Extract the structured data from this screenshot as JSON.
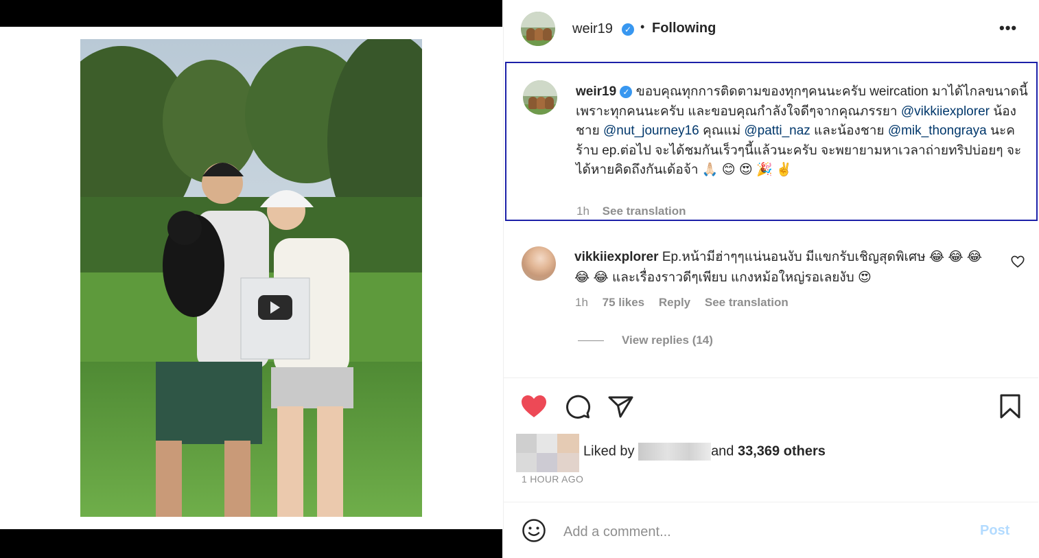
{
  "post": {
    "username": "weir19",
    "verified_badge": "✓",
    "separator": "•",
    "follow_status": "Following",
    "more_icon": "more-options-icon",
    "more_glyph": "•••"
  },
  "caption": {
    "username": "weir19",
    "segments": [
      "ขอบคุณทุกการติดตามของทุกๆคนนะครับ weircation มาได้ไกลขนาดนี้ เพราะทุกคนนะครับ และขอบคุณกำลังใจดีๆจากคุณภรรยา ",
      "@vikkiiexplorer",
      " น้องชาย ",
      "@nut_journey16",
      " คุณแม่ ",
      "@patti_naz",
      " และน้องชาย ",
      "@mik_thongraya",
      " นะคร้าบ ep.ต่อไป จะได้ชมกันเร็วๆนี้แล้วนะครับ จะพยายามหาเวลาถ่ายทริปบ่อยๆ จะได้หายคิดถึงกันเด้อจ้า 🙏🏻 😊 😍 🎉 ✌️"
    ],
    "time": "1h",
    "see_translation": "See translation"
  },
  "comment": {
    "username": "vikkiiexplorer",
    "text": "Ep.หน้ามีฮ่าๆๆแน่นอนงับ มีแขกรับเชิญสุดพิเศษ 😂 😂 😂 😂 😂 และเรื่องราวดีๆเพียบ แกงหม้อใหญ่รอเลยงับ 😍",
    "time": "1h",
    "likes": "75 likes",
    "reply": "Reply",
    "see_translation": "See translation",
    "view_replies": "View replies (14)"
  },
  "likes": {
    "prefix": "Liked by",
    "suffix_and": "and",
    "others": "33,369 others",
    "time_ago": "1 HOUR AGO"
  },
  "comment_box": {
    "placeholder": "Add a comment...",
    "post_label": "Post"
  },
  "colors": {
    "like_red": "#ed4956",
    "link_blue": "#00376b",
    "verified_blue": "#3897f0",
    "post_disabled": "#b3dbff",
    "highlight_border": "#1c20a8"
  }
}
